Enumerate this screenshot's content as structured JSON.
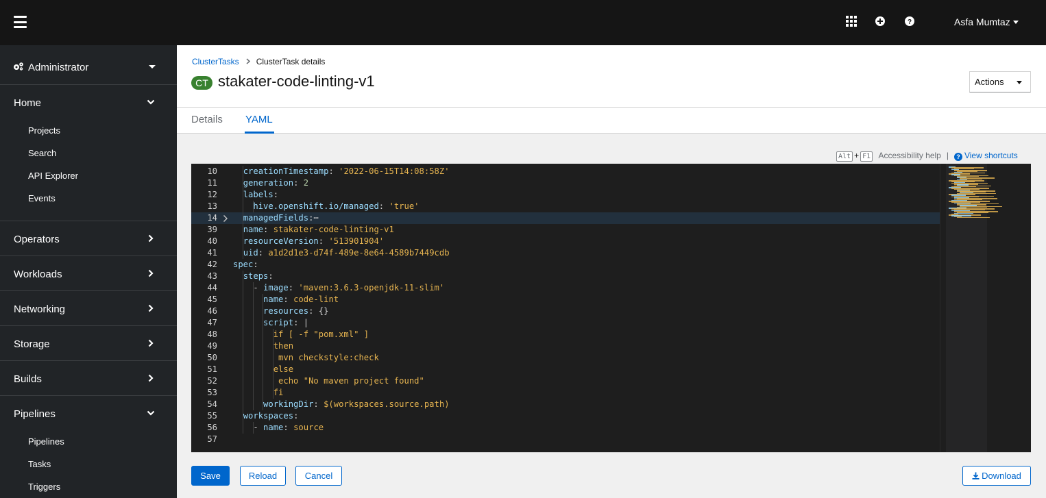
{
  "masthead": {
    "user_name": "Asfa Mumtaz",
    "icons": [
      "menu-icon",
      "grid-icon",
      "plus-circle-icon",
      "help-icon"
    ]
  },
  "sidebar": {
    "perspective": "Administrator",
    "home": {
      "label": "Home",
      "items": [
        "Projects",
        "Search",
        "API Explorer",
        "Events"
      ]
    },
    "operators": "Operators",
    "workloads": "Workloads",
    "networking": "Networking",
    "storage": "Storage",
    "builds": "Builds",
    "pipelines": {
      "label": "Pipelines",
      "items": [
        "Pipelines",
        "Tasks",
        "Triggers"
      ]
    }
  },
  "breadcrumb": {
    "parent": "ClusterTasks",
    "current": "ClusterTask details"
  },
  "header": {
    "badge": "CT",
    "title": "stakater-code-linting-v1",
    "actions_label": "Actions"
  },
  "tabs": {
    "details": "Details",
    "yaml": "YAML"
  },
  "accessibility": {
    "key1": "Alt",
    "plus": "+",
    "key2": "F1",
    "help": "Accessibility help",
    "separator": "|",
    "shortcuts": "View shortcuts"
  },
  "editor": {
    "lines": [
      {
        "n": "10",
        "parts": [
          [
            "w",
            "  "
          ],
          [
            "k",
            "creationTimestamp"
          ],
          [
            "p",
            ": "
          ],
          [
            "y",
            "'2022-06-15T14:08:58Z'"
          ]
        ]
      },
      {
        "n": "11",
        "parts": [
          [
            "w",
            "  "
          ],
          [
            "k",
            "generation"
          ],
          [
            "p",
            ": "
          ],
          [
            "n",
            "2"
          ]
        ]
      },
      {
        "n": "12",
        "parts": [
          [
            "w",
            "  "
          ],
          [
            "k",
            "labels"
          ],
          [
            "p",
            ":"
          ]
        ]
      },
      {
        "n": "13",
        "parts": [
          [
            "w",
            "    "
          ],
          [
            "k",
            "hive.openshift.io/managed"
          ],
          [
            "p",
            ": "
          ],
          [
            "y",
            "'true'"
          ]
        ]
      },
      {
        "n": "14",
        "fold": true,
        "hl": true,
        "parts": [
          [
            "w",
            "  "
          ],
          [
            "k",
            "managedFields"
          ],
          [
            "p",
            ":⋯"
          ]
        ]
      },
      {
        "n": "39",
        "parts": [
          [
            "w",
            "  "
          ],
          [
            "k",
            "name"
          ],
          [
            "p",
            ": "
          ],
          [
            "y",
            "stakater-code-linting-v1"
          ]
        ]
      },
      {
        "n": "40",
        "parts": [
          [
            "w",
            "  "
          ],
          [
            "k",
            "resourceVersion"
          ],
          [
            "p",
            ": "
          ],
          [
            "y",
            "'513901904'"
          ]
        ]
      },
      {
        "n": "41",
        "parts": [
          [
            "w",
            "  "
          ],
          [
            "k",
            "uid"
          ],
          [
            "p",
            ": "
          ],
          [
            "y",
            "a1d2d1e3-d74f-489e-8e64-4589b7449cdb"
          ]
        ]
      },
      {
        "n": "42",
        "parts": [
          [
            "k",
            "spec"
          ],
          [
            "p",
            ":"
          ]
        ]
      },
      {
        "n": "43",
        "parts": [
          [
            "w",
            "  "
          ],
          [
            "k",
            "steps"
          ],
          [
            "p",
            ":"
          ]
        ]
      },
      {
        "n": "44",
        "parts": [
          [
            "w",
            "    "
          ],
          [
            "p",
            "- "
          ],
          [
            "k",
            "image"
          ],
          [
            "p",
            ": "
          ],
          [
            "y",
            "'maven:3.6.3-openjdk-11-slim'"
          ]
        ]
      },
      {
        "n": "45",
        "parts": [
          [
            "w",
            "      "
          ],
          [
            "k",
            "name"
          ],
          [
            "p",
            ": "
          ],
          [
            "y",
            "code-lint"
          ]
        ]
      },
      {
        "n": "46",
        "parts": [
          [
            "w",
            "      "
          ],
          [
            "k",
            "resources"
          ],
          [
            "p",
            ": {}"
          ]
        ]
      },
      {
        "n": "47",
        "parts": [
          [
            "w",
            "      "
          ],
          [
            "k",
            "script"
          ],
          [
            "p",
            ": |"
          ]
        ]
      },
      {
        "n": "48",
        "parts": [
          [
            "w",
            "        "
          ],
          [
            "y",
            "if [ -f \"pom.xml\" ]"
          ]
        ]
      },
      {
        "n": "49",
        "parts": [
          [
            "w",
            "        "
          ],
          [
            "y",
            "then"
          ]
        ]
      },
      {
        "n": "50",
        "parts": [
          [
            "w",
            "         "
          ],
          [
            "y",
            "mvn checkstyle:check"
          ]
        ]
      },
      {
        "n": "51",
        "parts": [
          [
            "w",
            "        "
          ],
          [
            "y",
            "else"
          ]
        ]
      },
      {
        "n": "52",
        "parts": [
          [
            "w",
            "         "
          ],
          [
            "y",
            "echo \"No maven project found\""
          ]
        ]
      },
      {
        "n": "53",
        "parts": [
          [
            "w",
            "        "
          ],
          [
            "y",
            "fi"
          ]
        ]
      },
      {
        "n": "54",
        "parts": [
          [
            "w",
            "      "
          ],
          [
            "k",
            "workingDir"
          ],
          [
            "p",
            ": "
          ],
          [
            "y",
            "$(workspaces.source.path)"
          ]
        ]
      },
      {
        "n": "55",
        "parts": [
          [
            "w",
            "  "
          ],
          [
            "k",
            "workspaces"
          ],
          [
            "p",
            ":"
          ]
        ]
      },
      {
        "n": "56",
        "parts": [
          [
            "w",
            "    "
          ],
          [
            "p",
            "- "
          ],
          [
            "k",
            "name"
          ],
          [
            "p",
            ": "
          ],
          [
            "y",
            "source"
          ]
        ]
      },
      {
        "n": "57",
        "parts": []
      }
    ]
  },
  "buttons": {
    "save": "Save",
    "reload": "Reload",
    "cancel": "Cancel",
    "download": "Download"
  },
  "colors": {
    "masthead": "#151515",
    "sidebar": "#212427",
    "primary": "#0066cc",
    "ct_badge": "#38812f",
    "editor_bg": "#1e1e1e"
  }
}
